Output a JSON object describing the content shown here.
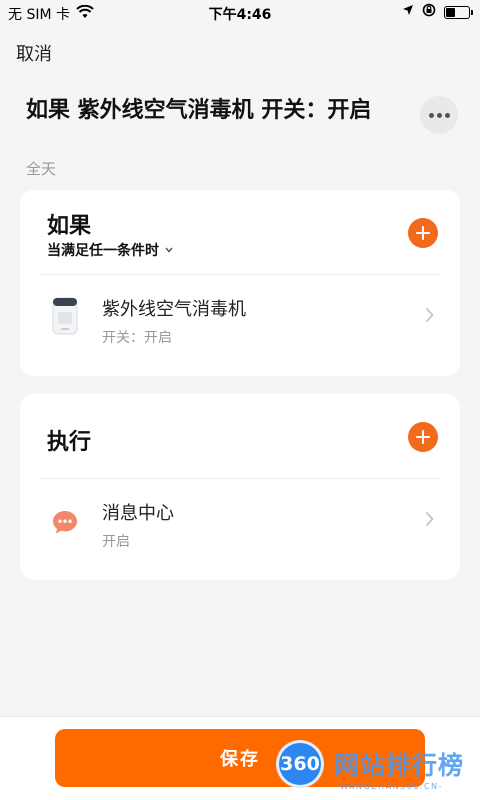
{
  "status_bar": {
    "carrier": "无 SIM 卡",
    "time": "下午4:46",
    "battery_level": 0.45
  },
  "nav": {
    "cancel_label": "取消"
  },
  "scene": {
    "title": "如果 紫外线空气消毒机 开关：开启",
    "schedule": "全天"
  },
  "condition_card": {
    "heading": "如果",
    "selector_label": "当满足任一条件时",
    "items": [
      {
        "title": "紫外线空气消毒机",
        "subtitle": "开关：开启",
        "icon": "air-purifier-icon"
      }
    ]
  },
  "action_card": {
    "heading": "执行",
    "items": [
      {
        "title": "消息中心",
        "subtitle": "开启",
        "icon": "message-bubble-icon"
      }
    ]
  },
  "footer": {
    "save_label": "保存"
  },
  "watermark": {
    "badge": "360",
    "name": "网站排行榜",
    "url": "WANGZHAN360.CN"
  },
  "colors": {
    "accent": "#f26b1d",
    "save_button": "#ff6a00",
    "background": "#f5f5f5",
    "card": "#ffffff",
    "secondary_text": "#999999"
  }
}
